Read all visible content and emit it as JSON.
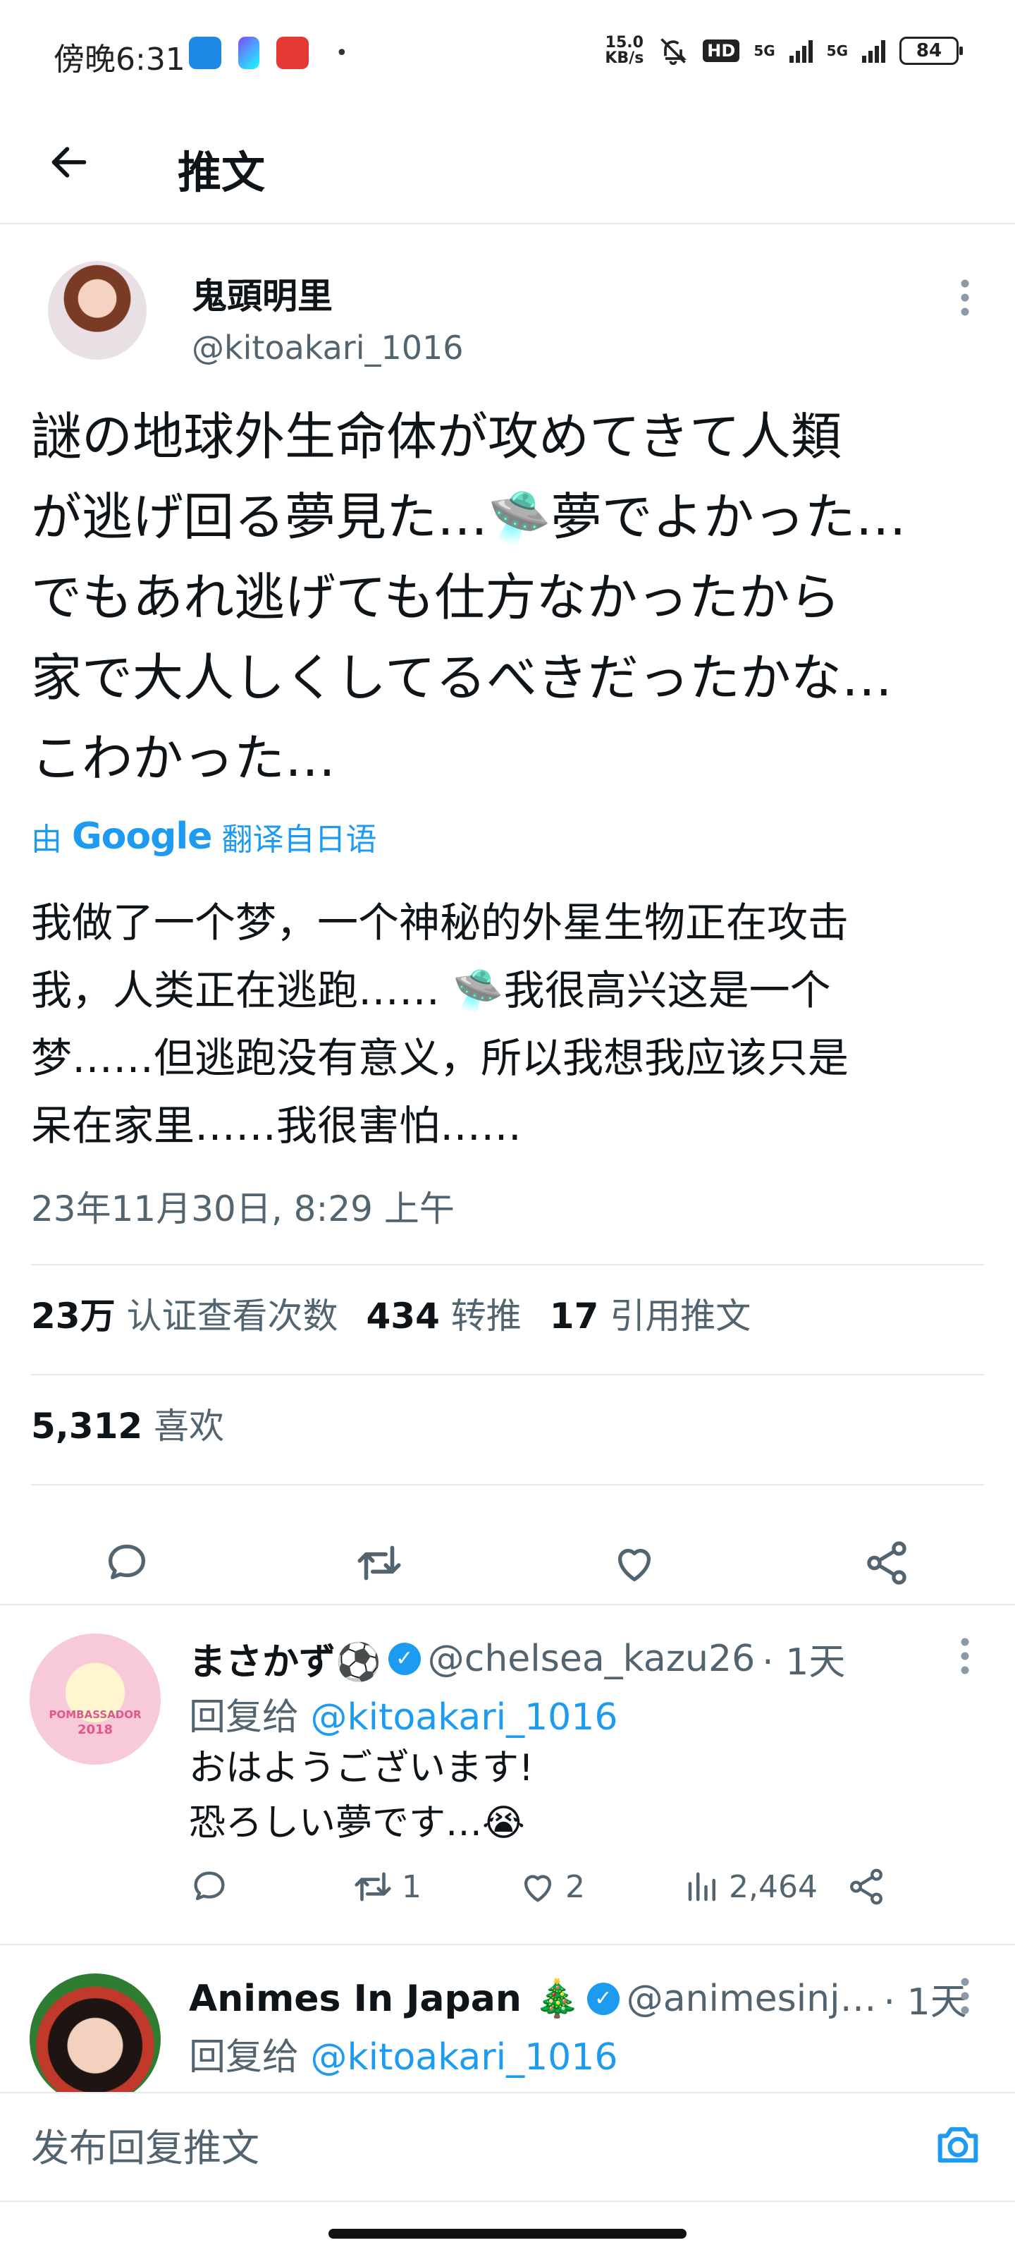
{
  "status_bar": {
    "time": "傍晚6:31",
    "net_speed_value": "15.0",
    "net_speed_unit": "KB/s",
    "hd": "HD",
    "sim1": "5G",
    "sim2": "5G",
    "battery": "84",
    "more_dot": "•"
  },
  "header": {
    "title": "推文"
  },
  "tweet": {
    "author_name": "鬼頭明里",
    "author_handle": "@kitoakari_1016",
    "text": "謎の地球外生命体が攻めてきて人類\nが逃げ回る夢見た…🛸夢でよかった…\nでもあれ逃げても仕方なかったから\n家で大人しくしてるべきだったかな…\nこわかった…",
    "translate_prefix": "由",
    "translate_brand": "Google",
    "translate_suffix": "翻译自日语",
    "translated_text": "我做了一个梦，一个神秘的外星生物正在攻击\n我，人类正在逃跑…… 🛸我很高兴这是一个\n梦……但逃跑没有意义，所以我想我应该只是\n呆在家里……我很害怕……",
    "timestamp": "23年11月30日, 8:29 上午",
    "views_count": "23万",
    "views_label": "认证查看次数",
    "retweets_count": "434",
    "retweets_label": "转推",
    "quotes_count": "17",
    "quotes_label": "引用推文",
    "likes_count": "5,312",
    "likes_label": "喜欢"
  },
  "replies": [
    {
      "name": "まさかず⚽",
      "handle": "@chelsea_kazu26",
      "time": "· 1天",
      "reply_to_label": "回复给",
      "reply_to_handle": "@kitoakari_1016",
      "text": "おはようございます!\n恐ろしい夢です…😭",
      "reply_count": "",
      "retweet_count": "1",
      "like_count": "2",
      "view_count": "2,464",
      "avatar_text": "POMBASSADOR",
      "avatar_year": "2018"
    },
    {
      "name": "Animes In Japan 🎄",
      "handle": "@animesinj…",
      "time": "· 1天",
      "reply_to_label": "回复给",
      "reply_to_handle": "@kitoakari_1016"
    }
  ],
  "composer": {
    "placeholder": "发布回复推文"
  },
  "icons": {
    "back": "arrow-left-icon",
    "more": "more-vertical-icon",
    "reply": "comment-icon",
    "retweet": "retweet-icon",
    "like": "heart-icon",
    "share": "share-icon",
    "views": "bar-chart-icon",
    "camera": "camera-icon",
    "verified": "verified-badge-icon"
  },
  "colors": {
    "accent": "#1d9bf0",
    "secondary_text": "#536471",
    "divider": "#e6e9ec",
    "text": "#0f1419"
  }
}
